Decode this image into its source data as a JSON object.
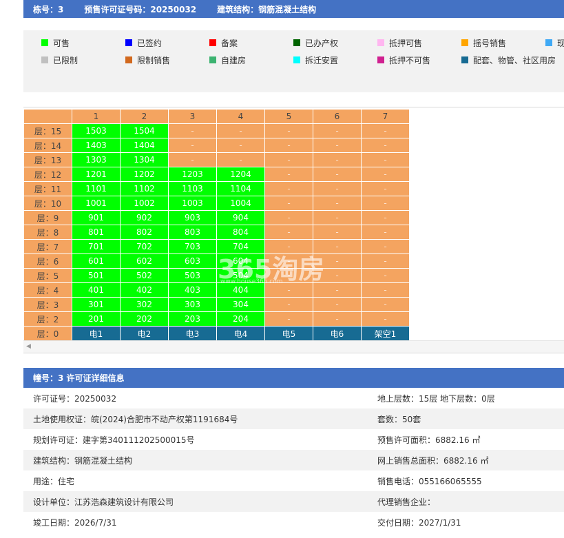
{
  "header": {
    "building": "栋号：3",
    "permit": "预售许可证号码：20250032",
    "structure": "建筑结构：钢筋混凝土结构"
  },
  "legend": [
    {
      "label": "可售",
      "color": "#00ff00"
    },
    {
      "label": "已签约",
      "color": "#0000ff"
    },
    {
      "label": "备案",
      "color": "#ff0000"
    },
    {
      "label": "已办产权",
      "color": "#006400"
    },
    {
      "label": "抵押可售",
      "color": "#ffb6f0"
    },
    {
      "label": "摇号销售",
      "color": "#ffa500"
    },
    {
      "label": "现",
      "color": "#3fa9f5"
    },
    {
      "label": "已限制",
      "color": "#c0c0c0"
    },
    {
      "label": "限制销售",
      "color": "#d2691e"
    },
    {
      "label": "自建房",
      "color": "#3cb371"
    },
    {
      "label": "拆迁安置",
      "color": "#00ffff"
    },
    {
      "label": "抵押不可售",
      "color": "#d02090"
    },
    {
      "label": "配套、物管、社区用房",
      "color": "#176b93"
    }
  ],
  "grid": {
    "columns": [
      "1",
      "2",
      "3",
      "4",
      "5",
      "6",
      "7"
    ],
    "floors": [
      {
        "label": "层：15",
        "units": [
          "1503",
          "1504",
          "-",
          "-",
          "-",
          "-",
          "-"
        ]
      },
      {
        "label": "层：14",
        "units": [
          "1403",
          "1404",
          "-",
          "-",
          "-",
          "-",
          "-"
        ]
      },
      {
        "label": "层：13",
        "units": [
          "1303",
          "1304",
          "-",
          "-",
          "-",
          "-",
          "-"
        ]
      },
      {
        "label": "层：12",
        "units": [
          "1201",
          "1202",
          "1203",
          "1204",
          "-",
          "-",
          "-"
        ]
      },
      {
        "label": "层：11",
        "units": [
          "1101",
          "1102",
          "1103",
          "1104",
          "-",
          "-",
          "-"
        ]
      },
      {
        "label": "层：10",
        "units": [
          "1001",
          "1002",
          "1003",
          "1004",
          "-",
          "-",
          "-"
        ]
      },
      {
        "label": "层：9",
        "units": [
          "901",
          "902",
          "903",
          "904",
          "-",
          "-",
          "-"
        ]
      },
      {
        "label": "层：8",
        "units": [
          "801",
          "802",
          "803",
          "804",
          "-",
          "-",
          "-"
        ]
      },
      {
        "label": "层：7",
        "units": [
          "701",
          "702",
          "703",
          "704",
          "-",
          "-",
          "-"
        ]
      },
      {
        "label": "层：6",
        "units": [
          "601",
          "602",
          "603",
          "604",
          "-",
          "-",
          "-"
        ]
      },
      {
        "label": "层：5",
        "units": [
          "501",
          "502",
          "503",
          "504",
          "-",
          "-",
          "-"
        ]
      },
      {
        "label": "层：4",
        "units": [
          "401",
          "402",
          "403",
          "404",
          "-",
          "-",
          "-"
        ]
      },
      {
        "label": "层：3",
        "units": [
          "301",
          "302",
          "303",
          "304",
          "-",
          "-",
          "-"
        ]
      },
      {
        "label": "层：2",
        "units": [
          "201",
          "202",
          "203",
          "204",
          "-",
          "-",
          "-"
        ]
      }
    ],
    "ground": {
      "label": "层：0",
      "units": [
        "电1",
        "电2",
        "电3",
        "电4",
        "电5",
        "电6",
        "架空1"
      ]
    }
  },
  "watermark": {
    "main": "365淘房",
    "sub": "www.house365.com"
  },
  "info": {
    "title": "幢号：3 许可证详细信息",
    "rows": [
      {
        "left": "许可证号：20250032",
        "right": "地上层数：15层  地下层数：0层"
      },
      {
        "left": "土地使用权证：皖(2024)合肥市不动产权第1191684号",
        "right": "套数：50套"
      },
      {
        "left": "规划许可证：建字第340111202500015号",
        "right": "预售许可面积：6882.16 ㎡"
      },
      {
        "left": "建筑结构：钢筋混凝土结构",
        "right": "网上销售总面积：6882.16 ㎡"
      },
      {
        "left": "用途：住宅",
        "right": "销售电话：055166065555"
      },
      {
        "left": "设计单位：江苏浩森建筑设计有限公司",
        "right": "代理销售企业："
      },
      {
        "left": "竣工日期：2026/7/31",
        "right": "交付日期：2027/1/31"
      }
    ]
  }
}
